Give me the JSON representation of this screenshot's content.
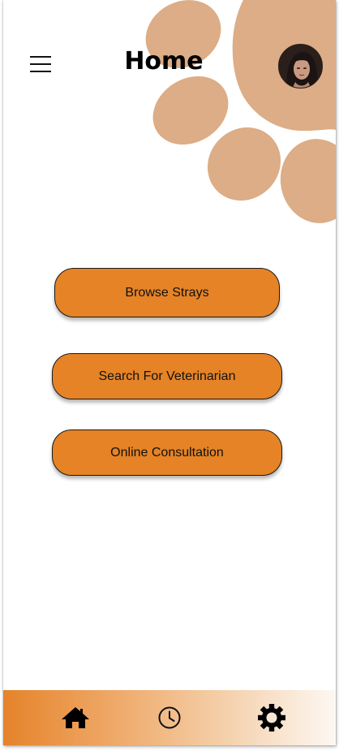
{
  "header": {
    "title": "Home"
  },
  "actions": {
    "browse_strays": "Browse Strays",
    "search_veterinarian": "Search For Veterinarian",
    "online_consultation": "Online Consultation"
  },
  "icons": {
    "menu": "hamburger-menu-icon",
    "avatar": "user-avatar",
    "home": "home-icon",
    "history": "clock-icon",
    "settings": "gear-icon"
  },
  "colors": {
    "accent": "#e58326",
    "paw": "#dcad86",
    "text": "#111111"
  }
}
